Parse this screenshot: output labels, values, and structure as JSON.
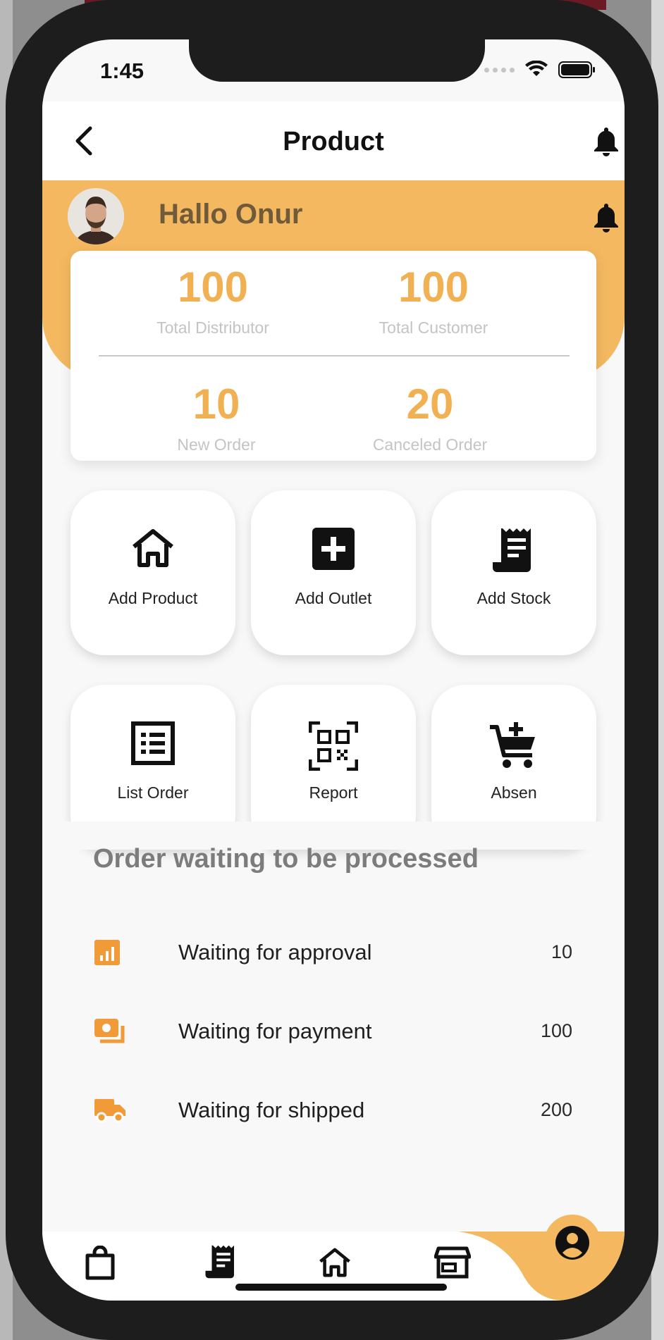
{
  "status_bar": {
    "time": "1:45"
  },
  "appbar": {
    "title": "Product"
  },
  "header": {
    "greeting": "Hallo Onur"
  },
  "stats": [
    {
      "value": "100",
      "label": "Total Distributor"
    },
    {
      "value": "100",
      "label": "Total Customer"
    },
    {
      "value": "10",
      "label": "New Order"
    },
    {
      "value": "20",
      "label": "Canceled Order"
    }
  ],
  "actions": [
    {
      "label": "Add Product",
      "icon": "home-icon"
    },
    {
      "label": "Add Outlet",
      "icon": "plus-box-icon"
    },
    {
      "label": "Add Stock",
      "icon": "receipt-icon"
    },
    {
      "label": "List Order",
      "icon": "list-icon"
    },
    {
      "label": "Report",
      "icon": "qr-code-icon"
    },
    {
      "label": "Absen",
      "icon": "cart-plus-icon"
    }
  ],
  "orders": {
    "title": "Order waiting to be processed",
    "items": [
      {
        "label": "Waiting for approval",
        "count": "10",
        "icon": "chart-icon"
      },
      {
        "label": "Waiting for payment",
        "count": "100",
        "icon": "payment-icon"
      },
      {
        "label": "Waiting for shipped",
        "count": "200",
        "icon": "truck-icon"
      }
    ]
  },
  "bottom_nav": [
    "shopping-bag-icon",
    "receipt-icon",
    "home-icon",
    "store-icon",
    "account-icon"
  ],
  "colors": {
    "accent": "#f3b860",
    "accent_text": "#f1b152",
    "icon_orange": "#f09a38"
  }
}
